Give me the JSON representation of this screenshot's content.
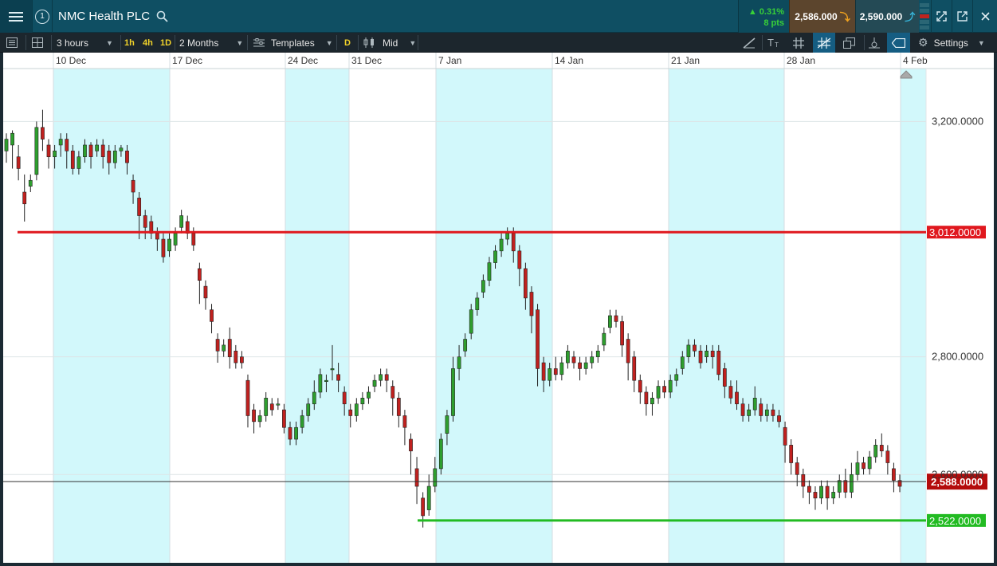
{
  "header": {
    "title": "NMC Health PLC",
    "change_pct": "0.31%",
    "change_pts": "8 pts",
    "sell_price": "2,586.000",
    "buy_price": "2,590.000",
    "alert_count": "1"
  },
  "toolbar": {
    "interval": "3 hours",
    "quick_1h": "1h",
    "quick_4h": "4h",
    "quick_1d": "1D",
    "range": "2 Months",
    "templates": "Templates",
    "d_badge": "D",
    "price_type": "Mid",
    "settings": "Settings"
  },
  "colors": {
    "up": "#2e9e2e",
    "down": "#c0211f",
    "weekend_band": "#d2f8fb",
    "resistance": "#e0181e",
    "support": "#22bb22",
    "titlebar": "#0f4f63"
  },
  "chart_data": {
    "type": "candlestick",
    "x_ticks": [
      "10 Dec",
      "17 Dec",
      "24 Dec",
      "31 Dec",
      "7 Jan",
      "14 Jan",
      "21 Jan",
      "28 Jan",
      "4 Feb"
    ],
    "y_ticks": [
      "3,200.0000",
      "2,800.0000",
      "2,600.0000"
    ],
    "y_tick_values": [
      3200,
      2800,
      2600
    ],
    "ylim": [
      2450,
      3290
    ],
    "horizontal_lines": [
      {
        "name": "resistance",
        "value": 3012,
        "label": "3,012.0000"
      },
      {
        "name": "support",
        "value": 2522,
        "label": "2,522.0000"
      }
    ],
    "current_price": {
      "value": 2588,
      "label": "2,588.0000"
    },
    "candles": [
      [
        3150,
        3170,
        3130,
        3180
      ],
      [
        3160,
        3180,
        3120,
        3185
      ],
      [
        3140,
        3120,
        3100,
        3160
      ],
      [
        3080,
        3060,
        3030,
        3110
      ],
      [
        3090,
        3100,
        3080,
        3110
      ],
      [
        3110,
        3190,
        3100,
        3200
      ],
      [
        3190,
        3170,
        3150,
        3220
      ],
      [
        3160,
        3140,
        3120,
        3170
      ],
      [
        3140,
        3150,
        3120,
        3160
      ],
      [
        3160,
        3170,
        3140,
        3180
      ],
      [
        3170,
        3150,
        3120,
        3180
      ],
      [
        3150,
        3120,
        3110,
        3160
      ],
      [
        3120,
        3140,
        3110,
        3150
      ],
      [
        3140,
        3160,
        3130,
        3170
      ],
      [
        3160,
        3140,
        3120,
        3165
      ],
      [
        3150,
        3160,
        3140,
        3170
      ],
      [
        3160,
        3140,
        3120,
        3170
      ],
      [
        3150,
        3130,
        3110,
        3160
      ],
      [
        3130,
        3150,
        3120,
        3160
      ],
      [
        3150,
        3155,
        3140,
        3160
      ],
      [
        3150,
        3130,
        3110,
        3160
      ],
      [
        3100,
        3080,
        3060,
        3110
      ],
      [
        3070,
        3040,
        3000,
        3080
      ],
      [
        3040,
        3020,
        3000,
        3050
      ],
      [
        3030,
        3010,
        3000,
        3040
      ],
      [
        3010,
        3000,
        2980,
        3020
      ],
      [
        3000,
        2970,
        2960,
        3010
      ],
      [
        2980,
        3000,
        2970,
        3010
      ],
      [
        2990,
        3010,
        2980,
        3020
      ],
      [
        3020,
        3040,
        3010,
        3050
      ],
      [
        3030,
        3010,
        3000,
        3040
      ],
      [
        3010,
        2990,
        2980,
        3020
      ],
      [
        2950,
        2930,
        2890,
        2960
      ],
      [
        2920,
        2900,
        2880,
        2930
      ],
      [
        2880,
        2860,
        2840,
        2890
      ],
      [
        2830,
        2810,
        2790,
        2840
      ],
      [
        2810,
        2820,
        2800,
        2830
      ],
      [
        2830,
        2800,
        2780,
        2850
      ],
      [
        2810,
        2790,
        2780,
        2820
      ],
      [
        2800,
        2790,
        2780,
        2810
      ],
      [
        2760,
        2700,
        2680,
        2770
      ],
      [
        2710,
        2690,
        2670,
        2720
      ],
      [
        2690,
        2700,
        2680,
        2710
      ],
      [
        2700,
        2730,
        2690,
        2740
      ],
      [
        2720,
        2710,
        2700,
        2730
      ],
      [
        2720,
        2720,
        2710,
        2730
      ],
      [
        2710,
        2680,
        2670,
        2720
      ],
      [
        2680,
        2660,
        2650,
        2690
      ],
      [
        2660,
        2680,
        2650,
        2690
      ],
      [
        2680,
        2700,
        2670,
        2710
      ],
      [
        2700,
        2720,
        2690,
        2730
      ],
      [
        2720,
        2740,
        2710,
        2760
      ],
      [
        2740,
        2770,
        2730,
        2780
      ],
      [
        2760,
        2760,
        2740,
        2770
      ],
      [
        2780,
        2780,
        2760,
        2820
      ],
      [
        2770,
        2760,
        2740,
        2790
      ],
      [
        2740,
        2720,
        2700,
        2750
      ],
      [
        2710,
        2700,
        2680,
        2720
      ],
      [
        2700,
        2720,
        2690,
        2730
      ],
      [
        2720,
        2730,
        2710,
        2740
      ],
      [
        2730,
        2740,
        2720,
        2750
      ],
      [
        2750,
        2760,
        2740,
        2770
      ],
      [
        2760,
        2770,
        2750,
        2780
      ],
      [
        2770,
        2760,
        2740,
        2780
      ],
      [
        2750,
        2730,
        2700,
        2760
      ],
      [
        2730,
        2700,
        2680,
        2740
      ],
      [
        2700,
        2680,
        2650,
        2710
      ],
      [
        2660,
        2640,
        2600,
        2670
      ],
      [
        2610,
        2580,
        2550,
        2630
      ],
      [
        2560,
        2530,
        2510,
        2570
      ],
      [
        2540,
        2580,
        2530,
        2600
      ],
      [
        2580,
        2610,
        2570,
        2630
      ],
      [
        2610,
        2660,
        2600,
        2670
      ],
      [
        2670,
        2700,
        2650,
        2710
      ],
      [
        2700,
        2780,
        2690,
        2800
      ],
      [
        2780,
        2800,
        2760,
        2820
      ],
      [
        2810,
        2830,
        2800,
        2840
      ],
      [
        2840,
        2880,
        2830,
        2890
      ],
      [
        2880,
        2900,
        2870,
        2910
      ],
      [
        2910,
        2930,
        2900,
        2940
      ],
      [
        2930,
        2960,
        2920,
        2970
      ],
      [
        2960,
        2980,
        2950,
        2990
      ],
      [
        2980,
        3000,
        2970,
        3010
      ],
      [
        3000,
        3010,
        2990,
        3020
      ],
      [
        3010,
        2980,
        2960,
        3020
      ],
      [
        2980,
        2950,
        2920,
        2990
      ],
      [
        2950,
        2900,
        2880,
        2960
      ],
      [
        2910,
        2870,
        2840,
        2920
      ],
      [
        2880,
        2780,
        2750,
        2890
      ],
      [
        2790,
        2760,
        2740,
        2800
      ],
      [
        2760,
        2780,
        2750,
        2790
      ],
      [
        2780,
        2770,
        2760,
        2800
      ],
      [
        2770,
        2790,
        2760,
        2800
      ],
      [
        2790,
        2810,
        2780,
        2820
      ],
      [
        2800,
        2790,
        2780,
        2810
      ],
      [
        2790,
        2780,
        2760,
        2800
      ],
      [
        2780,
        2790,
        2770,
        2800
      ],
      [
        2790,
        2800,
        2780,
        2810
      ],
      [
        2800,
        2810,
        2790,
        2820
      ],
      [
        2820,
        2840,
        2810,
        2850
      ],
      [
        2850,
        2870,
        2840,
        2880
      ],
      [
        2870,
        2860,
        2850,
        2880
      ],
      [
        2860,
        2820,
        2800,
        2870
      ],
      [
        2830,
        2790,
        2760,
        2840
      ],
      [
        2800,
        2760,
        2740,
        2810
      ],
      [
        2760,
        2740,
        2720,
        2770
      ],
      [
        2740,
        2720,
        2700,
        2750
      ],
      [
        2720,
        2730,
        2700,
        2740
      ],
      [
        2730,
        2750,
        2720,
        2760
      ],
      [
        2750,
        2740,
        2730,
        2760
      ],
      [
        2740,
        2760,
        2730,
        2770
      ],
      [
        2760,
        2770,
        2750,
        2780
      ],
      [
        2780,
        2800,
        2770,
        2810
      ],
      [
        2800,
        2820,
        2790,
        2830
      ],
      [
        2820,
        2810,
        2800,
        2830
      ],
      [
        2810,
        2790,
        2780,
        2820
      ],
      [
        2800,
        2810,
        2790,
        2820
      ],
      [
        2810,
        2800,
        2780,
        2820
      ],
      [
        2810,
        2770,
        2760,
        2820
      ],
      [
        2780,
        2750,
        2730,
        2790
      ],
      [
        2750,
        2730,
        2720,
        2760
      ],
      [
        2740,
        2720,
        2710,
        2760
      ],
      [
        2720,
        2700,
        2690,
        2730
      ],
      [
        2700,
        2710,
        2690,
        2720
      ],
      [
        2710,
        2730,
        2700,
        2750
      ],
      [
        2720,
        2700,
        2690,
        2730
      ],
      [
        2700,
        2710,
        2690,
        2720
      ],
      [
        2710,
        2700,
        2690,
        2720
      ],
      [
        2700,
        2690,
        2680,
        2710
      ],
      [
        2680,
        2650,
        2620,
        2690
      ],
      [
        2650,
        2620,
        2600,
        2660
      ],
      [
        2620,
        2600,
        2580,
        2630
      ],
      [
        2600,
        2580,
        2560,
        2610
      ],
      [
        2580,
        2570,
        2550,
        2590
      ],
      [
        2570,
        2560,
        2540,
        2580
      ],
      [
        2560,
        2580,
        2550,
        2590
      ],
      [
        2580,
        2560,
        2540,
        2590
      ],
      [
        2560,
        2570,
        2550,
        2580
      ],
      [
        2570,
        2590,
        2560,
        2600
      ],
      [
        2590,
        2570,
        2560,
        2610
      ],
      [
        2570,
        2600,
        2560,
        2620
      ],
      [
        2600,
        2620,
        2590,
        2640
      ],
      [
        2620,
        2610,
        2600,
        2630
      ],
      [
        2610,
        2630,
        2600,
        2640
      ],
      [
        2630,
        2650,
        2620,
        2660
      ],
      [
        2650,
        2640,
        2630,
        2670
      ],
      [
        2640,
        2620,
        2600,
        2650
      ],
      [
        2610,
        2590,
        2570,
        2620
      ],
      [
        2590,
        2580,
        2570,
        2600
      ]
    ]
  }
}
